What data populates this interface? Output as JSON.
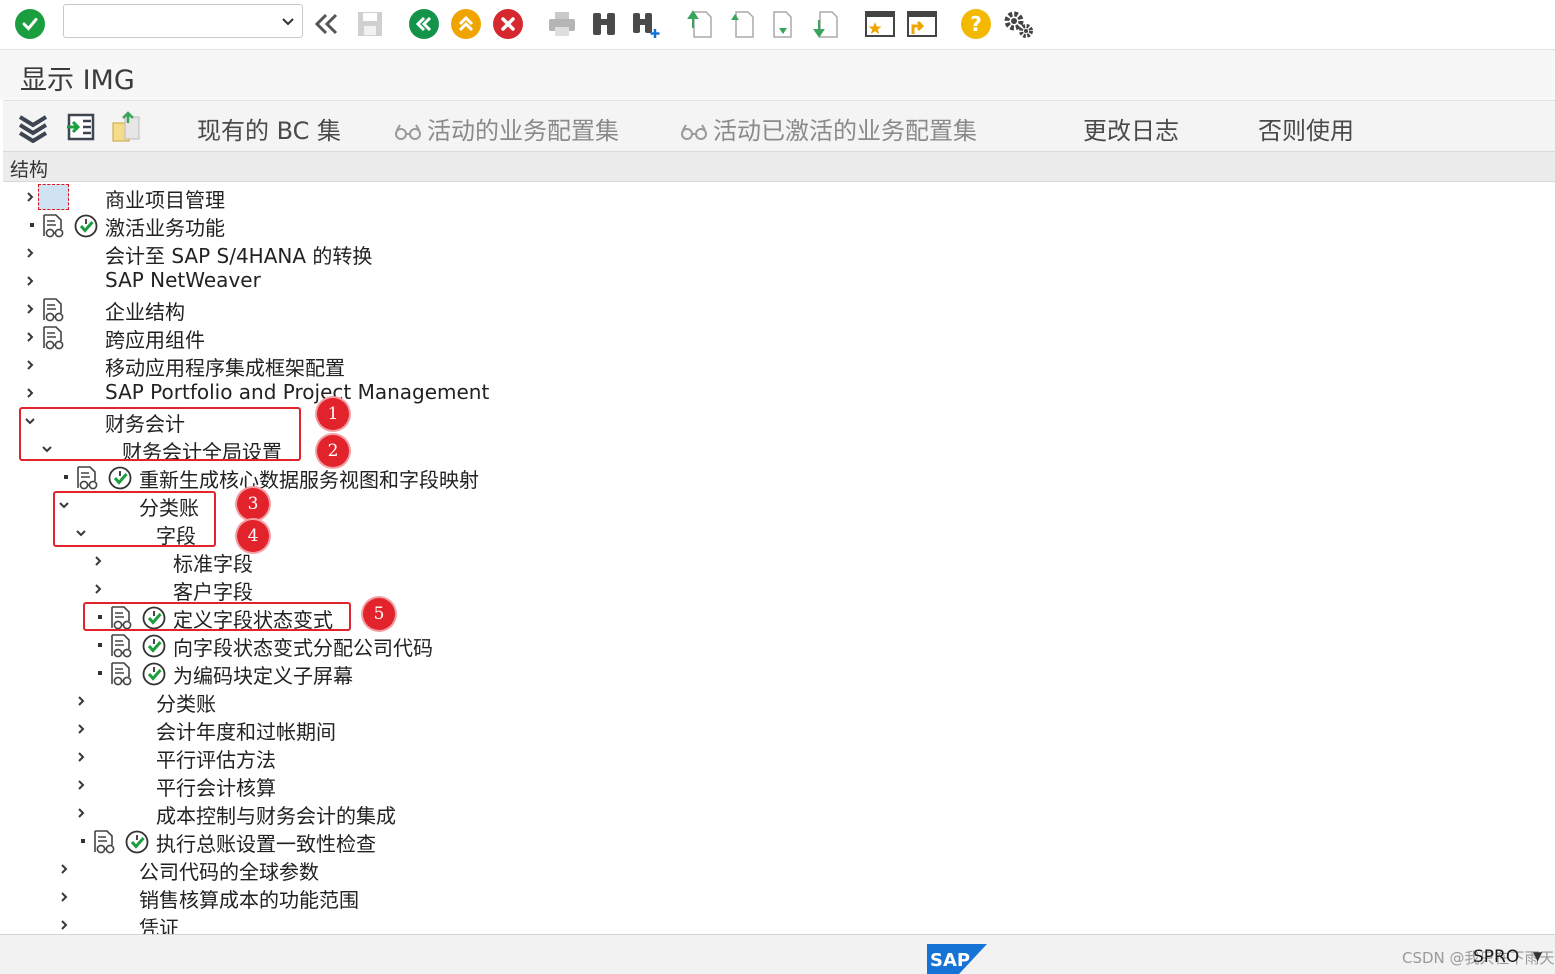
{
  "toolbar": {
    "command_field": {
      "value": "",
      "placeholder": ""
    },
    "icons": [
      "enter-icon",
      "save-icon",
      "back-icon",
      "exit-icon",
      "cancel-icon",
      "print-icon",
      "find-icon",
      "find-next-icon",
      "first-page-icon",
      "previous-page-icon",
      "next-page-icon",
      "last-page-icon",
      "new-session-icon",
      "shortcut-icon",
      "help-icon",
      "customize-layout-icon"
    ]
  },
  "title": "显示 IMG",
  "app_toolbar": {
    "buttons": [
      {
        "label": "现有的 BC 集",
        "enabled": true
      },
      {
        "label": "活动的业务配置集",
        "enabled": false
      },
      {
        "label": "活动已激活的业务配置集",
        "enabled": false
      },
      {
        "label": "更改日志",
        "enabled": true
      },
      {
        "label": "否则使用",
        "enabled": true
      }
    ]
  },
  "structure_header": "结构",
  "tree": [
    {
      "label": "商业项目管理",
      "level": 0,
      "expander": "collapsed",
      "doc": false,
      "exec": false,
      "placeholder_box": true
    },
    {
      "label": "激活业务功能",
      "level": 0,
      "expander": "leaf",
      "doc": true,
      "exec": true
    },
    {
      "label": "会计至 SAP S/4HANA 的转换",
      "level": 0,
      "expander": "collapsed",
      "doc": false,
      "exec": false
    },
    {
      "label": "SAP NetWeaver",
      "level": 0,
      "expander": "collapsed",
      "doc": false,
      "exec": false
    },
    {
      "label": "企业结构",
      "level": 0,
      "expander": "collapsed",
      "doc": true,
      "exec": false
    },
    {
      "label": "跨应用组件",
      "level": 0,
      "expander": "collapsed",
      "doc": true,
      "exec": false
    },
    {
      "label": "移动应用程序集成框架配置",
      "level": 0,
      "expander": "collapsed",
      "doc": false,
      "exec": false
    },
    {
      "label": "SAP Portfolio and Project Management",
      "level": 0,
      "expander": "collapsed",
      "doc": false,
      "exec": false
    },
    {
      "label": "财务会计",
      "level": 0,
      "expander": "expanded",
      "doc": false,
      "exec": false
    },
    {
      "label": "财务会计全局设置",
      "level": 1,
      "expander": "expanded",
      "doc": false,
      "exec": false
    },
    {
      "label": "重新生成核心数据服务视图和字段映射",
      "level": 2,
      "expander": "leaf",
      "doc": true,
      "exec": true
    },
    {
      "label": "分类账",
      "level": 2,
      "expander": "expanded",
      "doc": false,
      "exec": false
    },
    {
      "label": "字段",
      "level": 3,
      "expander": "expanded",
      "doc": false,
      "exec": false
    },
    {
      "label": "标准字段",
      "level": 4,
      "expander": "collapsed",
      "doc": false,
      "exec": false
    },
    {
      "label": "客户字段",
      "level": 4,
      "expander": "collapsed",
      "doc": false,
      "exec": false
    },
    {
      "label": "定义字段状态变式",
      "level": 4,
      "expander": "leaf",
      "doc": true,
      "exec": true
    },
    {
      "label": "向字段状态变式分配公司代码",
      "level": 4,
      "expander": "leaf",
      "doc": true,
      "exec": true
    },
    {
      "label": "为编码块定义子屏幕",
      "level": 4,
      "expander": "leaf",
      "doc": true,
      "exec": true
    },
    {
      "label": "分类账",
      "level": 3,
      "expander": "collapsed",
      "doc": false,
      "exec": false
    },
    {
      "label": "会计年度和过帐期间",
      "level": 3,
      "expander": "collapsed",
      "doc": false,
      "exec": false
    },
    {
      "label": "平行评估方法",
      "level": 3,
      "expander": "collapsed",
      "doc": false,
      "exec": false
    },
    {
      "label": "平行会计核算",
      "level": 3,
      "expander": "collapsed",
      "doc": false,
      "exec": false
    },
    {
      "label": "成本控制与财务会计的集成",
      "level": 3,
      "expander": "collapsed",
      "doc": false,
      "exec": false
    },
    {
      "label": "执行总账设置一致性检查",
      "level": 3,
      "expander": "leaf",
      "doc": true,
      "exec": true
    },
    {
      "label": "公司代码的全球参数",
      "level": 2,
      "expander": "collapsed",
      "doc": false,
      "exec": false
    },
    {
      "label": "销售核算成本的功能范围",
      "level": 2,
      "expander": "collapsed",
      "doc": false,
      "exec": false
    },
    {
      "label": "凭证",
      "level": 2,
      "expander": "collapsed",
      "doc": false,
      "exec": false
    }
  ],
  "annotations": [
    "1",
    "2",
    "3",
    "4",
    "5"
  ],
  "footer": {
    "logo_text": "SAP",
    "watermark": "CSDN @我只在下雨天",
    "transaction": "SPRO"
  },
  "colors": {
    "annotation_red": "#e3232c",
    "check_green": "#1a9e3f",
    "nav_green": "#13944a",
    "nav_orange": "#f0a400",
    "nav_red": "#d8282f",
    "help_yellow": "#f3b800",
    "sap_blue": "#1673d6"
  }
}
